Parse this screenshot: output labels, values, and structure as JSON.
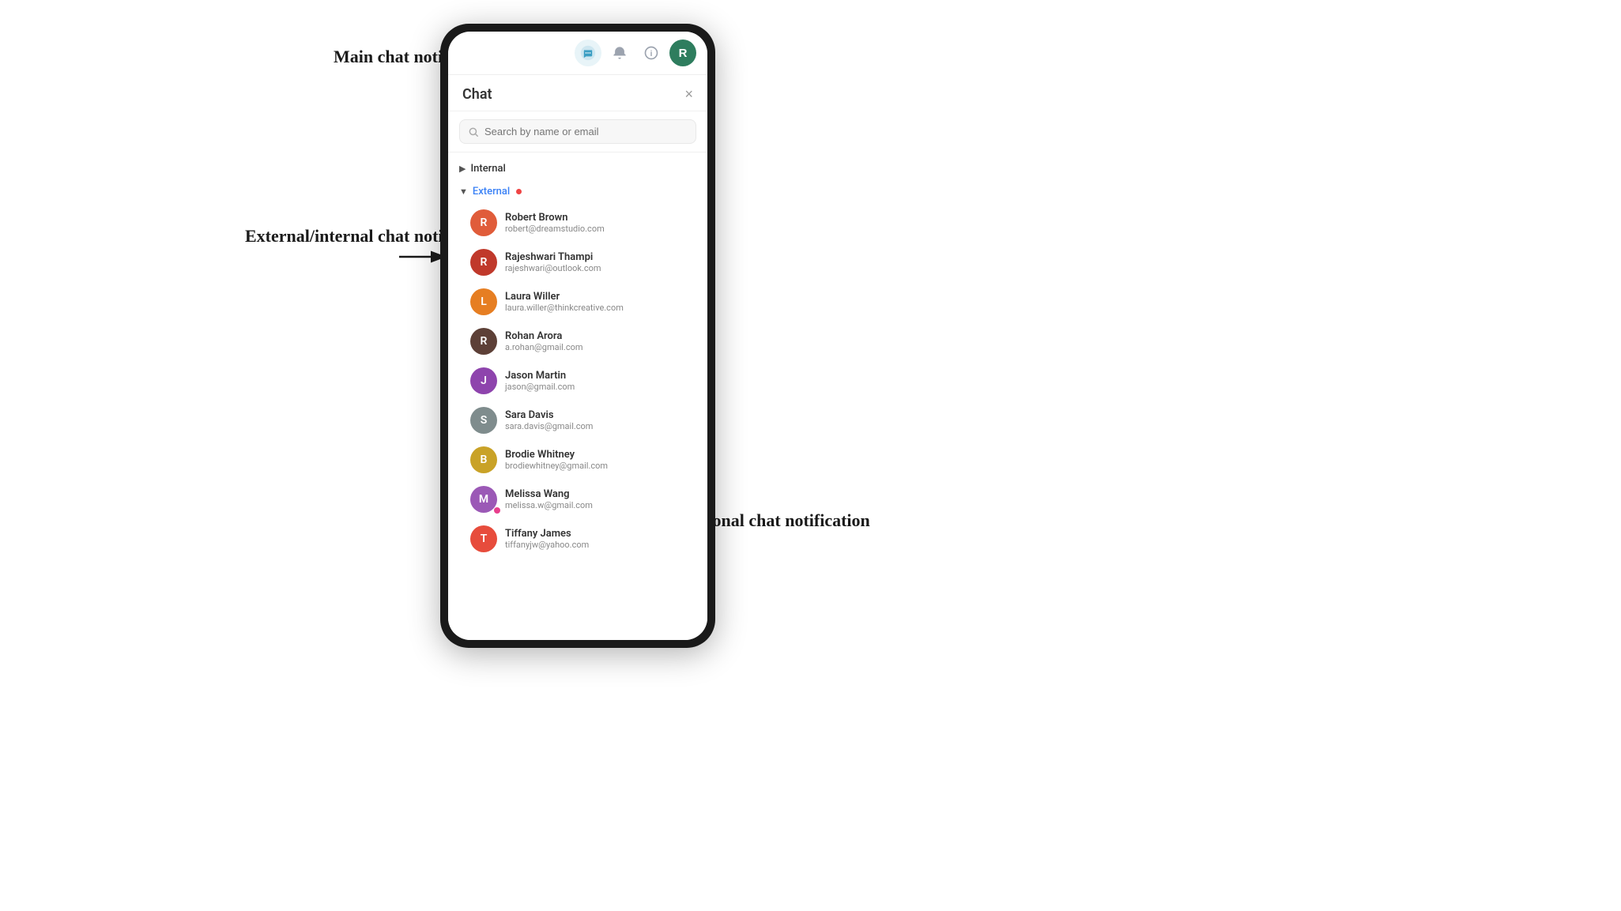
{
  "annotations": {
    "main_chat": "Main chat\nnotification",
    "ext_int": "External/internal\nchat notification",
    "personal": "Personal chat\nnotification"
  },
  "nav": {
    "avatar_initial": "R",
    "avatar_color": "#2e7d5e"
  },
  "chat_panel": {
    "title": "Chat",
    "close_label": "×",
    "search_placeholder": "Search by name or email"
  },
  "sections": {
    "internal_label": "Internal",
    "external_label": "External",
    "external_has_dot": true
  },
  "contacts": [
    {
      "name": "Robert Brown",
      "email": "robert@dreamstudio.com",
      "initial": "R",
      "color": "#e05c3a"
    },
    {
      "name": "Rajeshwari Thampi",
      "email": "rajeshwari@outlook.com",
      "initial": "R",
      "color": "#c0392b"
    },
    {
      "name": "Laura Willer",
      "email": "laura.willer@thinkcreative.com",
      "initial": "L",
      "color": "#e67e22"
    },
    {
      "name": "Rohan Arora",
      "email": "a.rohan@gmail.com",
      "initial": "R",
      "color": "#5d4037"
    },
    {
      "name": "Jason Martin",
      "email": "jason@gmail.com",
      "initial": "J",
      "color": "#8e44ad"
    },
    {
      "name": "Sara Davis",
      "email": "sara.davis@gmail.com",
      "initial": "S",
      "color": "#7f8c8d"
    },
    {
      "name": "Brodie Whitney",
      "email": "brodiewhitney@gmail.com",
      "initial": "B",
      "color": "#c9a227"
    },
    {
      "name": "Melissa Wang",
      "email": "melissa.w@gmail.com",
      "initial": "M",
      "color": "#9b59b6"
    },
    {
      "name": "Tiffany James",
      "email": "tiffanyjw@yahoo.com",
      "initial": "T",
      "color": "#e74c3c"
    }
  ]
}
